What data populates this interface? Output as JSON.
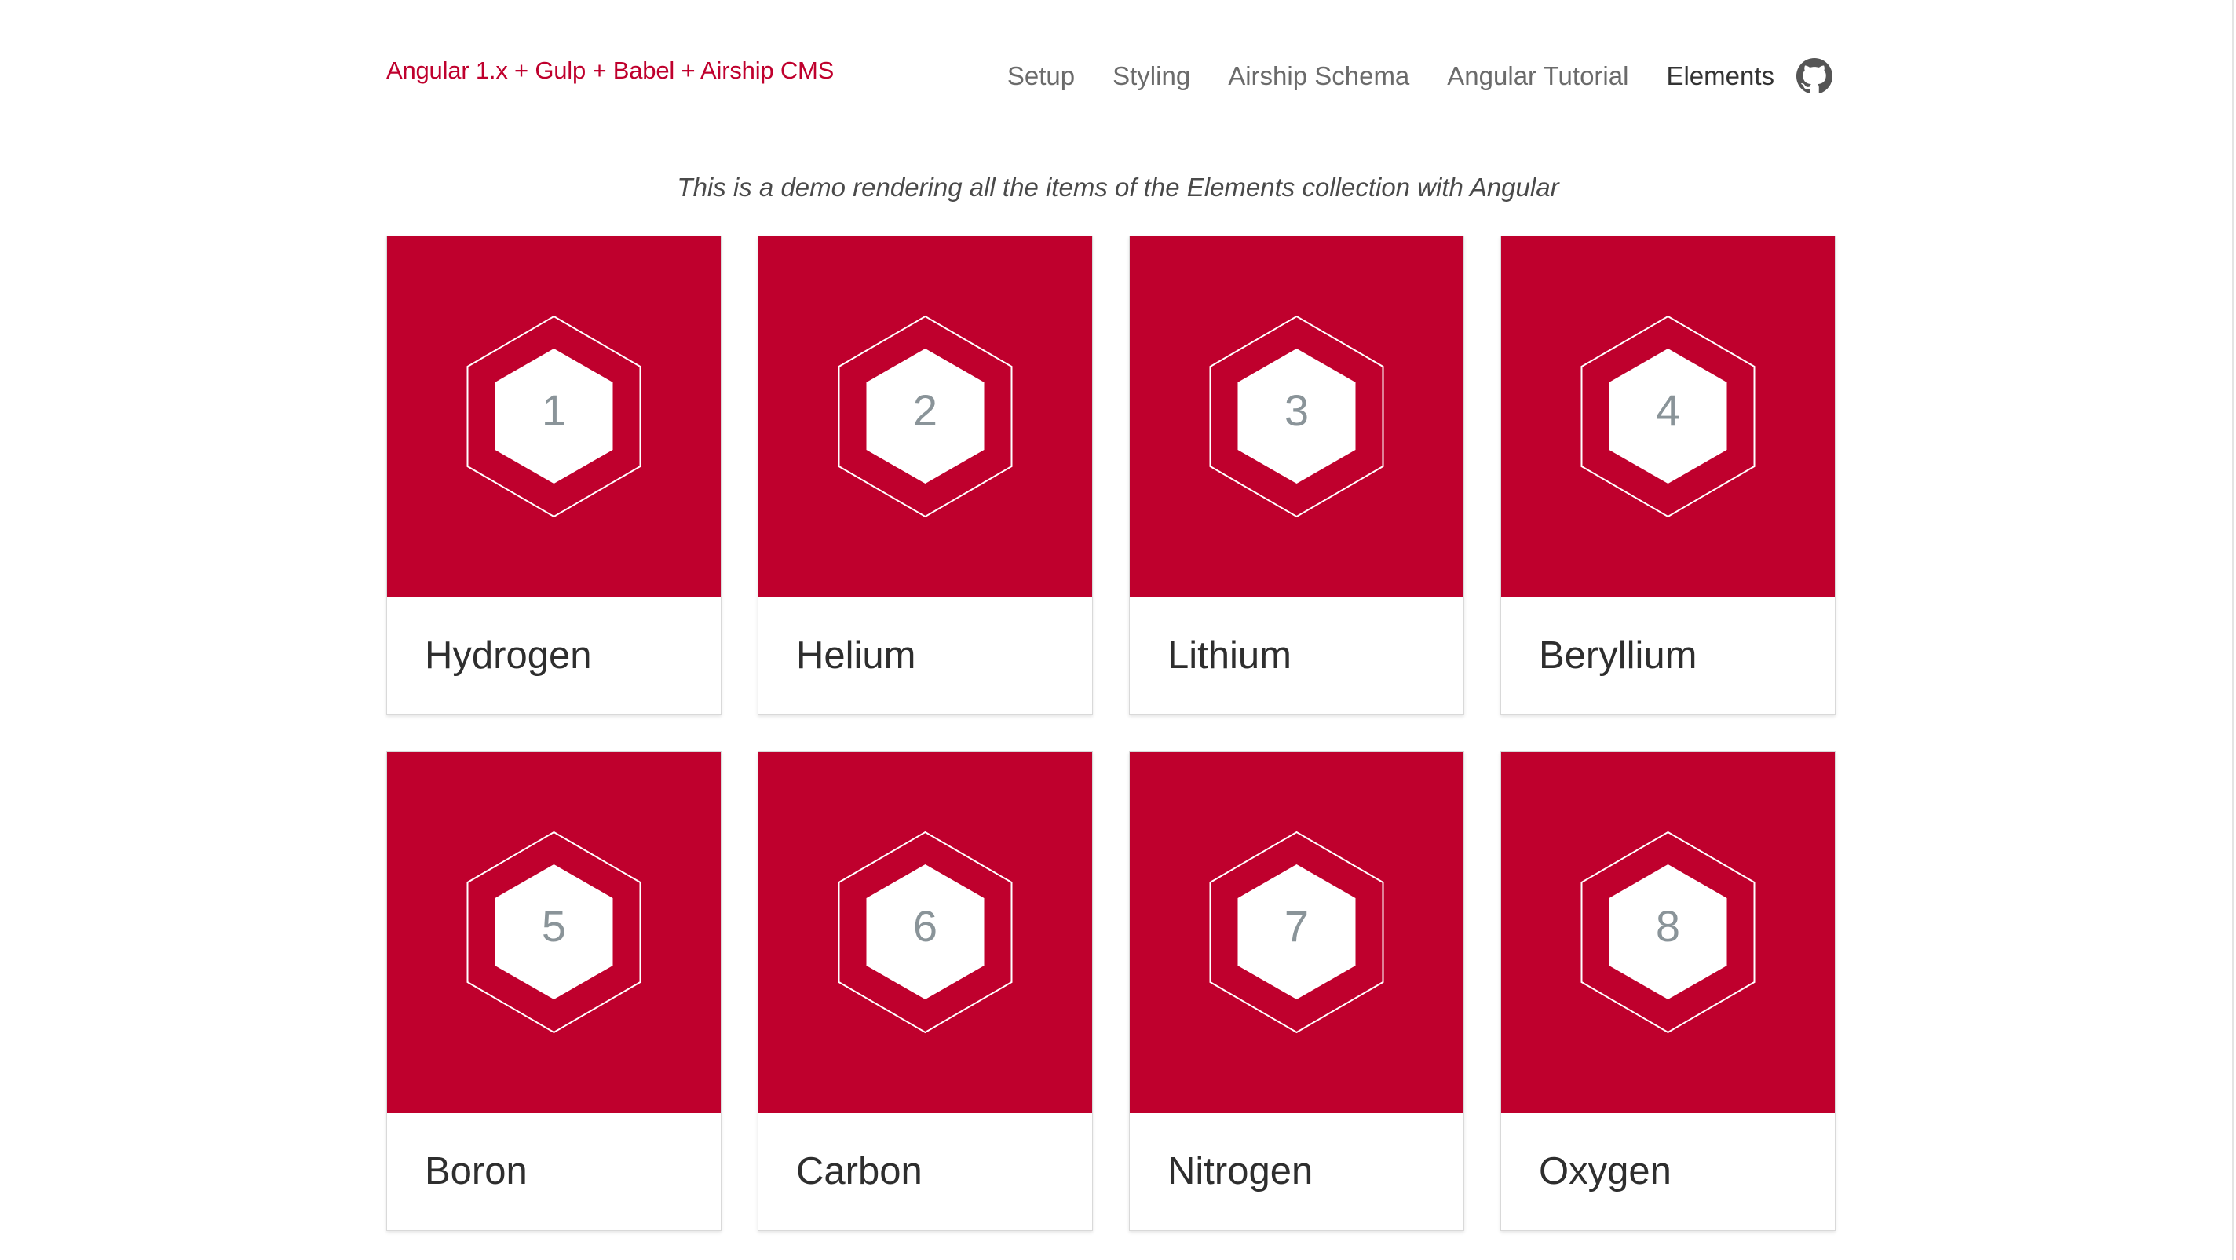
{
  "header": {
    "brand": "Angular 1.x + Gulp + Babel + Airship CMS",
    "nav": [
      {
        "label": "Setup",
        "active": false
      },
      {
        "label": "Styling",
        "active": false
      },
      {
        "label": "Airship Schema",
        "active": false
      },
      {
        "label": "Angular Tutorial",
        "active": false
      },
      {
        "label": "Elements",
        "active": true
      }
    ],
    "github_icon": "github-icon"
  },
  "tagline": "This is a demo rendering all the items of the Elements collection with Angular",
  "colors": {
    "accent": "#bf002d",
    "number": "#8a9499",
    "title": "#2e2e2e"
  },
  "elements": [
    {
      "number": "1",
      "name": "Hydrogen"
    },
    {
      "number": "2",
      "name": "Helium"
    },
    {
      "number": "3",
      "name": "Lithium"
    },
    {
      "number": "4",
      "name": "Beryllium"
    },
    {
      "number": "5",
      "name": "Boron"
    },
    {
      "number": "6",
      "name": "Carbon"
    },
    {
      "number": "7",
      "name": "Nitrogen"
    },
    {
      "number": "8",
      "name": "Oxygen"
    }
  ]
}
